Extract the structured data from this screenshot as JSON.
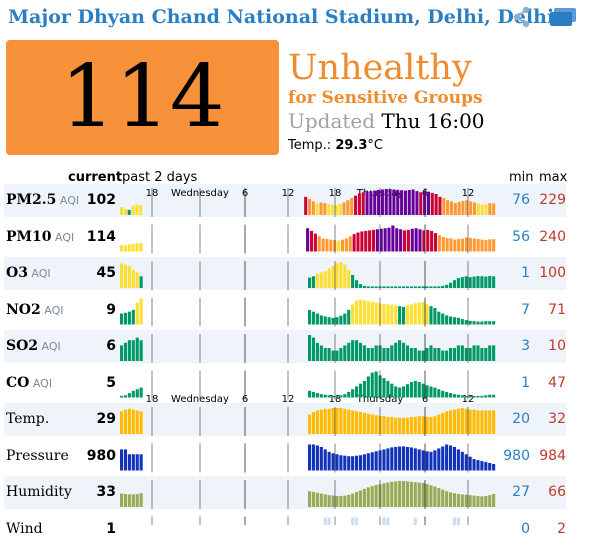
{
  "header": {
    "title": "Major Dhyan Chand National Stadium, Delhi, Delhi,",
    "icons": [
      "share-icon",
      "cards-icon"
    ]
  },
  "aqi": {
    "value": "114",
    "status_line1": "Unhealthy",
    "status_line2": "for Sensitive Groups",
    "updated_label": "Updated",
    "updated_value": "Thu 16:00",
    "temp_label": "Temp.:",
    "temp_value": "29.3",
    "temp_unit": "°C",
    "color": "#f7923a"
  },
  "table_header": {
    "current": "current",
    "past": "past 2 days",
    "min": "min",
    "max": "max"
  },
  "axis": {
    "ticks": [
      "18",
      "6",
      "12",
      "18",
      "6",
      "12"
    ],
    "day_labels": [
      "Wednesday",
      "Thursday"
    ]
  },
  "colors": {
    "good": "#009966",
    "moderate": "#ffde33",
    "usg": "#ff9933",
    "unhealthy": "#cc0033",
    "very_unhealthy": "#660099",
    "temp": "#ffbb00",
    "pressure": "#1133bb",
    "humidity": "#99aa55",
    "wind": "#ccddee"
  },
  "rows": [
    {
      "name": "PM2.5",
      "unit": "AQI",
      "current": "102",
      "min": "76",
      "max": "229",
      "values": [
        70,
        55,
        45,
        80,
        90,
        85,
        null,
        null,
        null,
        null,
        null,
        null,
        null,
        null,
        null,
        null,
        null,
        null,
        null,
        null,
        null,
        null,
        null,
        null,
        null,
        null,
        null,
        null,
        null,
        null,
        null,
        null,
        null,
        null,
        null,
        null,
        null,
        null,
        null,
        null,
        null,
        null,
        null,
        null,
        null,
        null,
        null,
        null,
        160,
        140,
        120,
        100,
        110,
        105,
        95,
        90,
        85,
        100,
        110,
        130,
        150,
        170,
        190,
        200,
        205,
        210,
        215,
        220,
        225,
        229,
        228,
        225,
        222,
        218,
        215,
        220,
        225,
        210,
        200,
        215,
        205,
        195,
        185,
        160,
        150,
        130,
        120,
        105,
        115,
        125,
        130,
        120,
        110,
        100,
        90,
        95,
        105,
        102
      ]
    },
    {
      "name": "PM10",
      "unit": "AQI",
      "current": "114",
      "min": "56",
      "max": "240",
      "values": [
        60,
        56,
        65,
        70,
        75,
        80,
        null,
        null,
        null,
        null,
        null,
        null,
        null,
        null,
        null,
        null,
        null,
        null,
        null,
        null,
        null,
        null,
        null,
        null,
        null,
        null,
        null,
        null,
        null,
        null,
        null,
        null,
        null,
        null,
        null,
        null,
        null,
        null,
        null,
        null,
        null,
        null,
        null,
        null,
        null,
        null,
        null,
        null,
        215,
        190,
        165,
        140,
        120,
        115,
        110,
        105,
        100,
        110,
        120,
        140,
        160,
        175,
        185,
        190,
        195,
        200,
        205,
        210,
        215,
        220,
        240,
        215,
        205,
        195,
        200,
        210,
        215,
        205,
        195,
        200,
        190,
        170,
        150,
        135,
        125,
        120,
        110,
        115,
        120,
        130,
        125,
        120,
        115,
        110,
        105,
        112,
        114
      ]
    },
    {
      "name": "O3",
      "unit": "AQI",
      "current": "45",
      "min": "1",
      "max": "100",
      "values": [
        95,
        90,
        85,
        70,
        60,
        45,
        null,
        null,
        null,
        null,
        null,
        null,
        null,
        null,
        null,
        null,
        null,
        null,
        null,
        null,
        null,
        null,
        null,
        null,
        null,
        null,
        null,
        null,
        null,
        null,
        null,
        null,
        null,
        null,
        null,
        null,
        null,
        null,
        null,
        null,
        null,
        null,
        null,
        null,
        null,
        null,
        null,
        null,
        40,
        45,
        55,
        60,
        65,
        75,
        85,
        95,
        100,
        90,
        70,
        50,
        30,
        15,
        8,
        5,
        4,
        3,
        2,
        2,
        1,
        1,
        1,
        2,
        2,
        3,
        3,
        4,
        4,
        3,
        3,
        4,
        5,
        6,
        8,
        12,
        20,
        30,
        38,
        42,
        45,
        42,
        44,
        46,
        45,
        44,
        46,
        45
      ]
    },
    {
      "name": "NO2",
      "unit": "AQI",
      "current": "9",
      "min": "7",
      "max": "71",
      "values": [
        30,
        32,
        35,
        40,
        60,
        71,
        null,
        null,
        null,
        null,
        null,
        null,
        null,
        null,
        null,
        null,
        null,
        null,
        null,
        null,
        null,
        null,
        null,
        null,
        null,
        null,
        null,
        null,
        null,
        null,
        null,
        null,
        null,
        null,
        null,
        null,
        null,
        null,
        null,
        null,
        null,
        null,
        null,
        null,
        null,
        null,
        null,
        null,
        40,
        35,
        30,
        25,
        22,
        20,
        18,
        20,
        24,
        30,
        40,
        55,
        65,
        68,
        66,
        64,
        62,
        60,
        58,
        56,
        55,
        54,
        52,
        50,
        48,
        52,
        55,
        58,
        60,
        62,
        55,
        50,
        45,
        35,
        30,
        25,
        22,
        20,
        18,
        15,
        12,
        10,
        9,
        8,
        8,
        9,
        9,
        9
      ]
    },
    {
      "name": "SO2",
      "unit": "AQI",
      "current": "6",
      "min": "3",
      "max": "10",
      "values": [
        6,
        7,
        8,
        8,
        9,
        8,
        null,
        null,
        null,
        null,
        null,
        null,
        null,
        null,
        null,
        null,
        null,
        null,
        null,
        null,
        null,
        null,
        null,
        null,
        null,
        null,
        null,
        null,
        null,
        null,
        null,
        null,
        null,
        null,
        null,
        null,
        null,
        null,
        null,
        null,
        null,
        null,
        null,
        null,
        null,
        null,
        null,
        null,
        10,
        9,
        7,
        6,
        5,
        5,
        4,
        4,
        5,
        6,
        7,
        8,
        8,
        7,
        6,
        5,
        5,
        6,
        6,
        5,
        5,
        6,
        7,
        8,
        7,
        6,
        5,
        5,
        4,
        4,
        5,
        6,
        5,
        5,
        4,
        4,
        5,
        5,
        6,
        6,
        5,
        5,
        6,
        6,
        5,
        5,
        6,
        6
      ]
    },
    {
      "name": "CO",
      "unit": "AQI",
      "current": "5",
      "min": "1",
      "max": "47",
      "values": [
        3,
        4,
        8,
        12,
        15,
        18,
        null,
        null,
        null,
        null,
        null,
        null,
        null,
        null,
        null,
        null,
        null,
        null,
        null,
        null,
        null,
        null,
        null,
        null,
        null,
        null,
        null,
        null,
        null,
        null,
        null,
        null,
        null,
        null,
        null,
        null,
        null,
        null,
        null,
        null,
        null,
        null,
        null,
        null,
        null,
        null,
        null,
        null,
        12,
        10,
        8,
        6,
        5,
        4,
        3,
        3,
        4,
        6,
        10,
        15,
        20,
        25,
        30,
        38,
        45,
        47,
        40,
        35,
        30,
        25,
        20,
        18,
        20,
        24,
        28,
        30,
        28,
        25,
        22,
        20,
        18,
        15,
        12,
        10,
        8,
        6,
        5,
        4,
        3,
        2,
        2,
        3,
        3,
        4,
        5,
        5
      ]
    },
    {
      "name": "Temp.",
      "unit": "",
      "current": "29",
      "min": "20",
      "max": "32",
      "values": [
        28,
        30,
        31,
        30,
        29,
        28,
        null,
        null,
        null,
        null,
        null,
        null,
        null,
        null,
        null,
        null,
        null,
        null,
        null,
        null,
        null,
        null,
        null,
        null,
        null,
        null,
        null,
        null,
        null,
        null,
        null,
        null,
        null,
        null,
        null,
        null,
        null,
        null,
        null,
        null,
        null,
        null,
        null,
        null,
        null,
        null,
        null,
        null,
        24,
        27,
        29,
        30,
        31,
        31,
        32,
        32,
        32,
        31,
        30,
        29,
        28,
        27,
        26,
        25,
        24,
        23,
        22,
        22,
        21,
        21,
        20,
        20,
        20,
        20,
        21,
        21,
        22,
        22,
        21,
        21,
        22,
        24,
        26,
        28,
        29,
        30,
        31,
        32,
        31,
        30,
        30,
        29,
        29,
        29,
        29,
        29
      ]
    },
    {
      "name": "Pressure",
      "unit": "",
      "current": "980",
      "min": "980",
      "max": "984",
      "values": [
        983,
        983,
        982,
        982,
        982,
        982,
        null,
        null,
        null,
        null,
        null,
        null,
        null,
        null,
        null,
        null,
        null,
        null,
        null,
        null,
        null,
        null,
        null,
        null,
        null,
        null,
        null,
        null,
        null,
        null,
        null,
        null,
        null,
        null,
        null,
        null,
        null,
        null,
        null,
        null,
        null,
        null,
        null,
        null,
        null,
        null,
        null,
        null,
        984,
        984,
        983.8,
        983.5,
        983,
        982.5,
        982.2,
        982,
        981.8,
        981.7,
        981.6,
        981.6,
        981.7,
        981.8,
        982,
        982.2,
        982.4,
        982.6,
        982.8,
        983,
        983.2,
        983.4,
        983.5,
        983.6,
        983.6,
        983.5,
        983.4,
        983.2,
        983,
        982.8,
        982.6,
        982.5,
        982.8,
        983.2,
        983.6,
        984,
        983.8,
        983.5,
        983,
        982.5,
        982,
        981.5,
        981,
        980.8,
        980.6,
        980.4,
        980.2,
        980
      ]
    },
    {
      "name": "Humidity",
      "unit": "",
      "current": "33",
      "min": "27",
      "max": "66",
      "values": [
        34,
        33,
        32,
        32,
        33,
        35,
        null,
        null,
        null,
        null,
        null,
        null,
        null,
        null,
        null,
        null,
        null,
        null,
        null,
        null,
        null,
        null,
        null,
        null,
        null,
        null,
        null,
        null,
        null,
        null,
        null,
        null,
        null,
        null,
        null,
        null,
        null,
        null,
        null,
        null,
        null,
        null,
        null,
        null,
        null,
        null,
        null,
        null,
        40,
        38,
        36,
        34,
        32,
        30,
        29,
        28,
        28,
        29,
        31,
        34,
        38,
        42,
        46,
        50,
        53,
        56,
        58,
        60,
        62,
        64,
        65,
        66,
        66,
        65,
        64,
        63,
        62,
        61,
        58,
        55,
        52,
        48,
        44,
        40,
        37,
        35,
        33,
        32,
        31,
        30,
        29,
        28,
        27,
        28,
        30,
        33
      ]
    },
    {
      "name": "Wind",
      "unit": "",
      "current": "1",
      "min": "0",
      "max": "2",
      "values": [
        1,
        1,
        1,
        1,
        1,
        1,
        null,
        null,
        null,
        null,
        null,
        null,
        null,
        null,
        null,
        null,
        null,
        null,
        null,
        null,
        null,
        null,
        null,
        null,
        null,
        null,
        null,
        null,
        null,
        null,
        null,
        null,
        null,
        null,
        null,
        null,
        null,
        null,
        null,
        null,
        null,
        null,
        null,
        null,
        null,
        null,
        null,
        null,
        1,
        1,
        1,
        1,
        2,
        2,
        1,
        1,
        1,
        1,
        1,
        2,
        2,
        1,
        1,
        1,
        1,
        1,
        1,
        2,
        2,
        1,
        1,
        1,
        1,
        1,
        1,
        2,
        1,
        1,
        1,
        1,
        1,
        1,
        1,
        1,
        1,
        2,
        2,
        1,
        1,
        1,
        1,
        1,
        1,
        1,
        1,
        1
      ]
    }
  ]
}
